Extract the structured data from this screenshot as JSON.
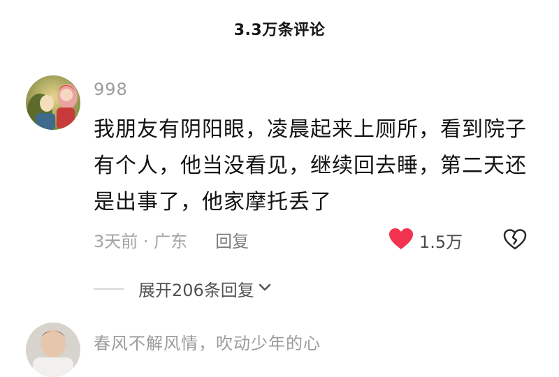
{
  "header": {
    "title": "3.3万条评论"
  },
  "comment": {
    "username": "998",
    "text": "我朋友有阴阳眼，凌晨起来上厕所，看到院子有个人，他当没看见，继续回去睡，第二天还是出事了，他家摩托丢了",
    "time_location": "3天前 · 广东",
    "reply_label": "回复",
    "like_count": "1.5万",
    "expand_label": "展开206条回复"
  },
  "next_comment": {
    "username": "春风不解风情，吹动少年的心"
  },
  "colors": {
    "like_heart": "#f2334f",
    "text_primary": "#121212",
    "text_secondary": "#9b9b9b"
  },
  "icons": {
    "like": "heart-filled-icon",
    "dislike": "broken-heart-icon",
    "expand": "chevron-down-icon"
  }
}
